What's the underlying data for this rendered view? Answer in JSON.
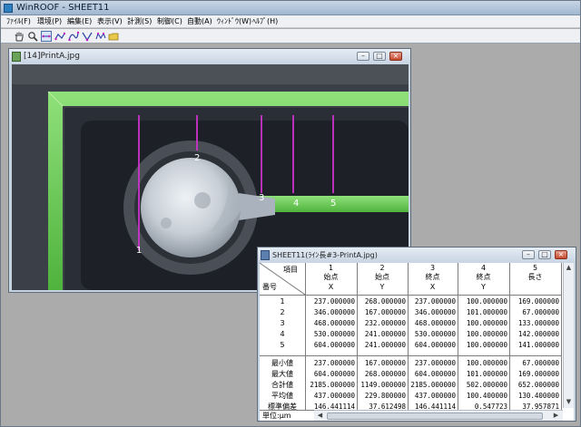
{
  "app": {
    "title": "WinROOF - SHEET11",
    "menu": [
      "ﾌｧｲﾙ(F)",
      "環境(P)",
      "編集(E)",
      "表示(V)",
      "計測(S)",
      "制御(C)",
      "自動(A)",
      "ｳｨﾝﾄﾞｳ(W)",
      "ﾍﾙﾌﾟ(H)"
    ]
  },
  "toolbar": {
    "buttons": [
      "hand-icon",
      "zoom-icon",
      "line-length-icon",
      "polyline-icon",
      "curve-icon",
      "angle-icon",
      "multi-point-icon",
      "folder-icon"
    ]
  },
  "image_window": {
    "title": "[14]PrintA.jpg",
    "markers": [
      "1",
      "2",
      "3",
      "4",
      "5"
    ],
    "colors": {
      "trace": "#6fd35c",
      "pad": "#d9dde2",
      "marker_line": "#cc33cc",
      "board": "#2a2e36"
    }
  },
  "sheet_window": {
    "title": "SHEET11(ﾗｲﾝ長#3-PrintA.jpg)",
    "corner_top": "項目",
    "corner_bottom": "番号",
    "columns": [
      {
        "index": "1",
        "name": "始点",
        "sub": "X"
      },
      {
        "index": "2",
        "name": "始点",
        "sub": "Y"
      },
      {
        "index": "3",
        "name": "終点",
        "sub": "X"
      },
      {
        "index": "4",
        "name": "終点",
        "sub": "Y"
      },
      {
        "index": "5",
        "name": "長さ",
        "sub": ""
      }
    ],
    "rows": [
      {
        "no": "1",
        "values": [
          "237.000000",
          "268.000000",
          "237.000000",
          "100.000000",
          "169.000000"
        ]
      },
      {
        "no": "2",
        "values": [
          "346.000000",
          "167.000000",
          "346.000000",
          "101.000000",
          "67.000000"
        ]
      },
      {
        "no": "3",
        "values": [
          "468.000000",
          "232.000000",
          "468.000000",
          "100.000000",
          "133.000000"
        ]
      },
      {
        "no": "4",
        "values": [
          "530.000000",
          "241.000000",
          "530.000000",
          "100.000000",
          "142.000000"
        ]
      },
      {
        "no": "5",
        "values": [
          "604.000000",
          "241.000000",
          "604.000000",
          "100.000000",
          "141.000000"
        ]
      }
    ],
    "stats": [
      {
        "label": "最小値",
        "values": [
          "237.000000",
          "167.000000",
          "237.000000",
          "100.000000",
          "67.000000"
        ]
      },
      {
        "label": "最大値",
        "values": [
          "604.000000",
          "268.000000",
          "604.000000",
          "101.000000",
          "169.000000"
        ]
      },
      {
        "label": "合計値",
        "values": [
          "2185.000000",
          "1149.000000",
          "2185.000000",
          "502.000000",
          "652.000000"
        ]
      },
      {
        "label": "平均値",
        "values": [
          "437.000000",
          "229.800000",
          "437.000000",
          "100.400000",
          "130.400000"
        ]
      },
      {
        "label": "標準偏差",
        "values": [
          "146.441114",
          "37.612498",
          "146.441114",
          "0.547723",
          "37.957871"
        ]
      }
    ],
    "unit_label": "単位:μm"
  }
}
